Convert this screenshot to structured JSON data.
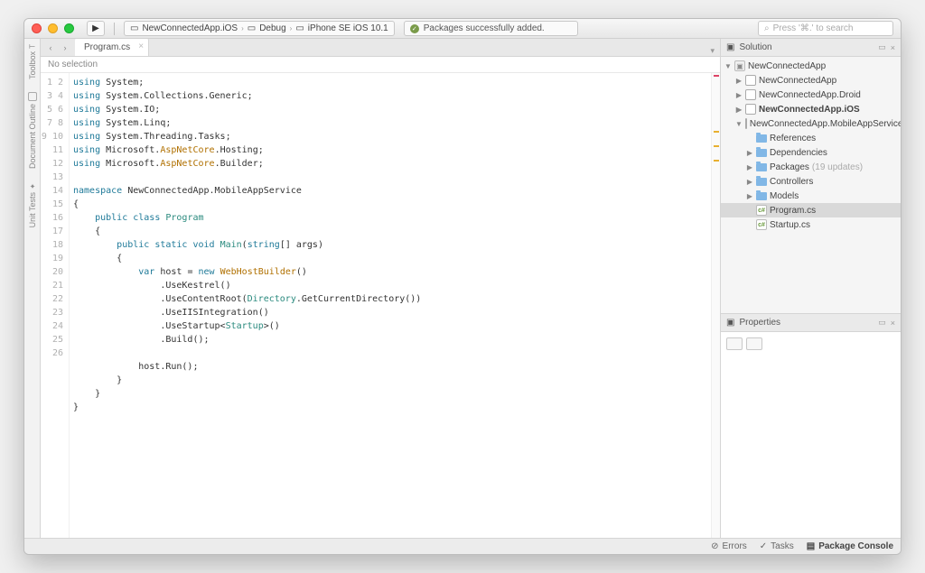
{
  "toolbar": {
    "project": "NewConnectedApp.iOS",
    "config": "Debug",
    "device": "iPhone SE iOS 10.1",
    "status": "Packages successfully added.",
    "search_placeholder": "Press '⌘.' to search"
  },
  "left_rail": {
    "toolbox": "Toolbox",
    "doc_outline": "Document Outline",
    "unit_tests": "Unit Tests"
  },
  "tabs": {
    "active": "Program.cs"
  },
  "breadcrumb": "No selection",
  "solution_panel": {
    "title": "Solution",
    "root": "NewConnectedApp",
    "projects": [
      {
        "name": "NewConnectedApp",
        "bold": false,
        "expanded": false
      },
      {
        "name": "NewConnectedApp.Droid",
        "bold": false,
        "expanded": false
      },
      {
        "name": "NewConnectedApp.iOS",
        "bold": true,
        "expanded": false
      },
      {
        "name": "NewConnectedApp.MobileAppService",
        "bold": false,
        "expanded": true
      }
    ],
    "folders": [
      {
        "name": "References",
        "noexpand": true
      },
      {
        "name": "Dependencies",
        "noexpand": false
      },
      {
        "name": "Packages",
        "suffix": "(19 updates)",
        "noexpand": false
      },
      {
        "name": "Controllers",
        "noexpand": false
      },
      {
        "name": "Models",
        "noexpand": false
      }
    ],
    "files": [
      {
        "name": "Program.cs",
        "selected": true
      },
      {
        "name": "Startup.cs",
        "selected": false
      }
    ]
  },
  "properties_panel": {
    "title": "Properties"
  },
  "statusbar": {
    "errors": "Errors",
    "tasks": "Tasks",
    "console": "Package Console"
  },
  "code": {
    "lines": 26,
    "tokens": [
      [
        [
          "using ",
          "kw"
        ],
        [
          "System",
          ""
        ],
        [
          ";",
          ""
        ]
      ],
      [
        [
          "using ",
          "kw"
        ],
        [
          "System.Collections.Generic",
          ""
        ],
        [
          ";",
          ""
        ]
      ],
      [
        [
          "using ",
          "kw"
        ],
        [
          "System.IO",
          ""
        ],
        [
          ";",
          ""
        ]
      ],
      [
        [
          "using ",
          "kw"
        ],
        [
          "System.Linq",
          ""
        ],
        [
          ";",
          ""
        ]
      ],
      [
        [
          "using ",
          "kw"
        ],
        [
          "System.Threading.Tasks",
          ""
        ],
        [
          ";",
          ""
        ]
      ],
      [
        [
          "using ",
          "kw"
        ],
        [
          "Microsoft.",
          ""
        ],
        [
          "AspNetCore",
          "ns"
        ],
        [
          ".Hosting;",
          ""
        ]
      ],
      [
        [
          "using ",
          "kw"
        ],
        [
          "Microsoft.",
          ""
        ],
        [
          "AspNetCore",
          "ns"
        ],
        [
          ".Builder;",
          ""
        ]
      ],
      [
        [
          "",
          ""
        ]
      ],
      [
        [
          "namespace ",
          "kw"
        ],
        [
          "NewConnectedApp.MobileAppService",
          ""
        ]
      ],
      [
        [
          "{",
          ""
        ]
      ],
      [
        [
          "    ",
          ""
        ],
        [
          "public class ",
          "kw"
        ],
        [
          "Program",
          "type"
        ]
      ],
      [
        [
          "    {",
          ""
        ]
      ],
      [
        [
          "        ",
          ""
        ],
        [
          "public static void ",
          "kw"
        ],
        [
          "Main",
          "type"
        ],
        [
          "(",
          ""
        ],
        [
          "string",
          "kw"
        ],
        [
          "[] args)",
          ""
        ]
      ],
      [
        [
          "        {",
          ""
        ]
      ],
      [
        [
          "            ",
          ""
        ],
        [
          "var ",
          "kw"
        ],
        [
          "host = ",
          ""
        ],
        [
          "new ",
          "kw"
        ],
        [
          "WebHostBuilder",
          "ns"
        ],
        [
          "()",
          ""
        ]
      ],
      [
        [
          "                .UseKestrel()",
          ""
        ]
      ],
      [
        [
          "                .UseContentRoot(",
          ""
        ],
        [
          "Directory",
          "type"
        ],
        [
          ".GetCurrentDirectory())",
          ""
        ]
      ],
      [
        [
          "                .UseIISIntegration()",
          ""
        ]
      ],
      [
        [
          "                .UseStartup<",
          ""
        ],
        [
          "Startup",
          "type"
        ],
        [
          ">()",
          ""
        ]
      ],
      [
        [
          "                .Build();",
          ""
        ]
      ],
      [
        [
          "",
          ""
        ]
      ],
      [
        [
          "            host.Run();",
          ""
        ]
      ],
      [
        [
          "        }",
          ""
        ]
      ],
      [
        [
          "    }",
          ""
        ]
      ],
      [
        [
          "}",
          ""
        ]
      ],
      [
        [
          "",
          ""
        ]
      ]
    ]
  }
}
